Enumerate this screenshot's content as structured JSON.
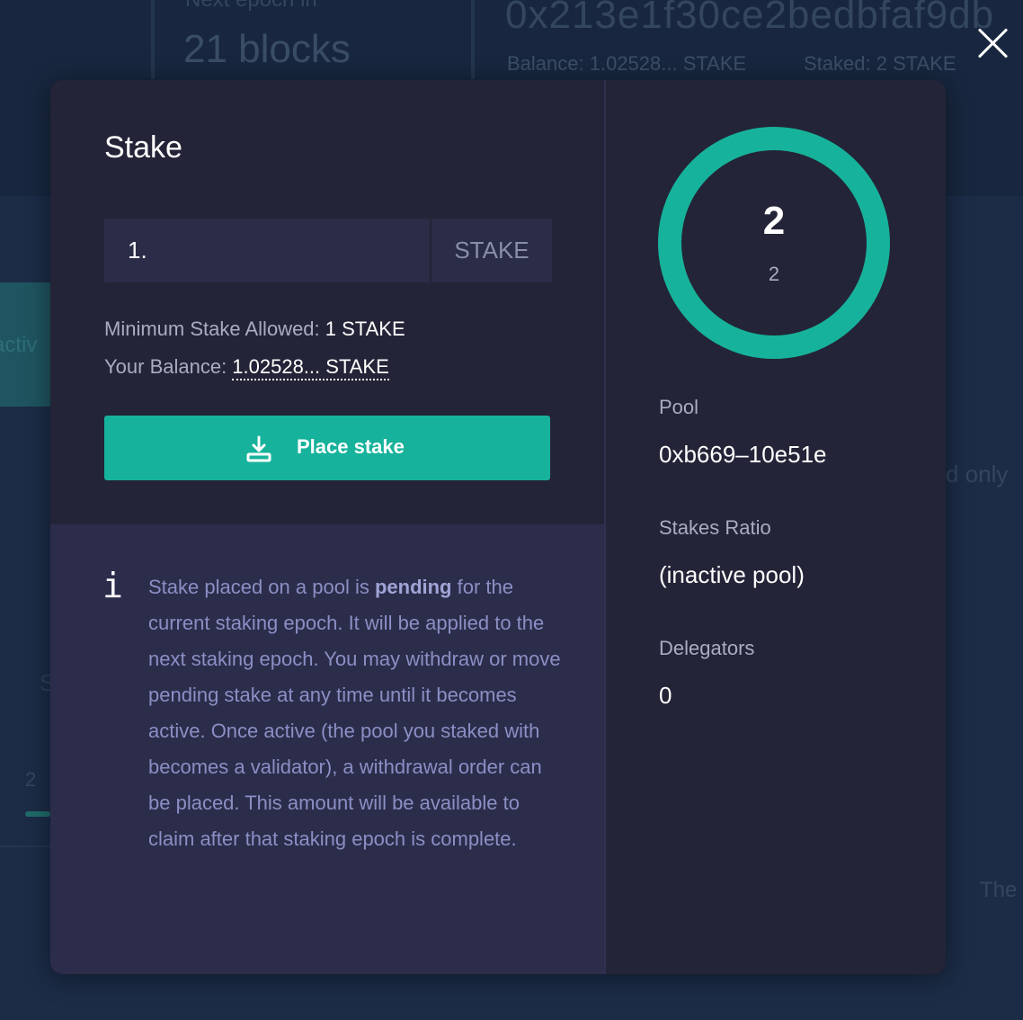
{
  "background": {
    "epoch_label": "Next epoch in",
    "epoch_value": "21 blocks",
    "address": "0x213e1f30ce2bedbfaf9db",
    "balance": "Balance: 1.02528... STAKE",
    "staked": "Staked: 2 STAKE",
    "tab_label": "activ",
    "readonly_text": "d only",
    "s_text": "S",
    "count_text": "2",
    "footer_text": "The"
  },
  "modal": {
    "title": "Stake",
    "stake_input": {
      "value": "1.",
      "unit": "STAKE"
    },
    "min_stake": {
      "label": "Minimum Stake Allowed: ",
      "value": "1 STAKE"
    },
    "balance": {
      "label": "Your Balance: ",
      "value": "1.02528... STAKE"
    },
    "place_button": {
      "label": "Place stake",
      "icon": "download-icon"
    },
    "info": {
      "icon": "i",
      "text_before": "Stake placed on a pool is ",
      "text_bold": "pending",
      "text_after": " for the current staking epoch. It will be applied to the next staking epoch. You may withdraw or move pending stake at any time until it becomes active. Once active (the pool you staked with becomes a validator), a withdrawal order can be placed. This amount will be available to claim after that staking epoch is complete."
    },
    "pool_stats": {
      "ring_value": "2",
      "ring_sub": "2",
      "ring_color": "#17b29b",
      "pool_label": "Pool",
      "pool_value": "0xb669–10e51e",
      "ratio_label": "Stakes Ratio",
      "ratio_value": "(inactive pool)",
      "delegators_label": "Delegators",
      "delegators_value": "0"
    }
  },
  "close_icon": "close-icon",
  "colors": {
    "accent": "#17b29b",
    "modal_bg": "#232437",
    "info_bg": "#2c2d4b"
  }
}
